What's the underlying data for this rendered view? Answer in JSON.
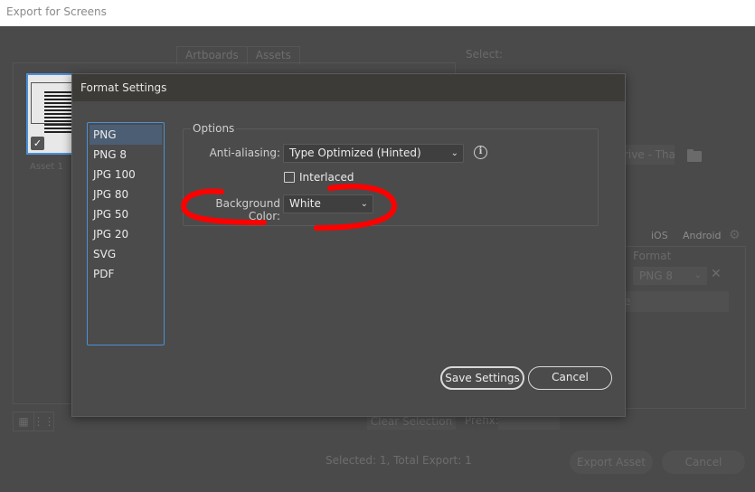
{
  "window": {
    "title": "Export for Screens"
  },
  "background_dialog": {
    "tabs": [
      "Artboards",
      "Assets"
    ],
    "asset_label": "Asset 1",
    "select_label": "Select:",
    "path_field_value": "rive - Tha",
    "platforms": [
      "iOS",
      "Android"
    ],
    "format_column_label": "Format",
    "format_select_value": "PNG 8",
    "suffix_field_value": "e",
    "clear_selection_label": "Clear Selection",
    "prefix_label": "Prefix:",
    "prefix_value": "",
    "selected_info": "Selected: 1, Total Export: 1",
    "export_button_label": "Export Asset",
    "cancel_button_label": "Cancel"
  },
  "modal": {
    "title": "Format Settings",
    "formats": [
      {
        "label": "PNG",
        "selected": true
      },
      {
        "label": "PNG 8",
        "selected": false
      },
      {
        "label": "JPG 100",
        "selected": false
      },
      {
        "label": "JPG 80",
        "selected": false
      },
      {
        "label": "JPG 50",
        "selected": false
      },
      {
        "label": "JPG 20",
        "selected": false
      },
      {
        "label": "SVG",
        "selected": false
      },
      {
        "label": "PDF",
        "selected": false
      }
    ],
    "options": {
      "legend": "Options",
      "anti_aliasing_label": "Anti-aliasing:",
      "anti_aliasing_value": "Type Optimized (Hinted)",
      "interlaced_label": "Interlaced",
      "interlaced_checked": false,
      "background_color_label": "Background Color:",
      "background_color_value": "White"
    },
    "save_button_label": "Save Settings",
    "cancel_button_label": "Cancel"
  },
  "icons": {
    "dropdown_chevron": "⌄",
    "info": "i",
    "checkmark": "✓",
    "close": "✕",
    "gear": "⚙",
    "grid_view": "▦",
    "list_view": "⋮⋮"
  },
  "colors": {
    "selection_blue": "#4a90d9",
    "selected_item_bg": "#4c5e73",
    "annotation_red": "#ff0000",
    "dialog_bg": "#4b4b4b",
    "header_bg": "#3c3b37"
  }
}
